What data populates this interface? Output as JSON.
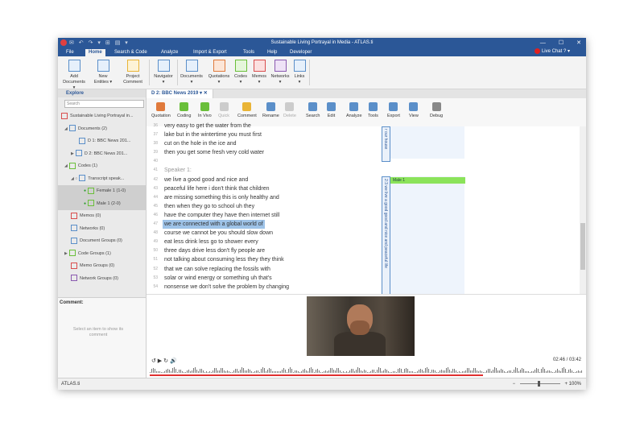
{
  "window": {
    "title": "Sustainable Living Portrayal in Media - ATLAS.ti",
    "controls": [
      "—",
      "☐",
      "✕"
    ],
    "quick_access": "✉ ↶ ↷ ▾   ⊞ ▤ ▾"
  },
  "menu": {
    "tabs": [
      "File",
      "Home",
      "Search & Code",
      "Analyze",
      "Import & Export",
      "Tools",
      "Help",
      "Developer"
    ],
    "active": "Home",
    "live_chat": "Live Chat",
    "help": "? ▾"
  },
  "ribbon": {
    "buttons": [
      {
        "l1": "Add",
        "l2": "Documents ▾",
        "color": "#5b8fc9"
      },
      {
        "l1": "New",
        "l2": "Entities ▾",
        "color": "#5b8fc9"
      },
      {
        "l1": "Project",
        "l2": "Comment",
        "color": "#e9b436"
      },
      {
        "l1": "Navigator",
        "l2": "▾",
        "color": "#5b8fc9"
      },
      {
        "l1": "Documents",
        "l2": "▾",
        "color": "#5b8fc9"
      },
      {
        "l1": "Quotations",
        "l2": "▾",
        "color": "#e07a3c"
      },
      {
        "l1": "Codes",
        "l2": "▾",
        "color": "#6abf3a"
      },
      {
        "l1": "Memos",
        "l2": "▾",
        "color": "#d94d4d"
      },
      {
        "l1": "Networks",
        "l2": "▾",
        "color": "#8a5ab0"
      },
      {
        "l1": "Links",
        "l2": "▾",
        "color": "#5b8fc9"
      }
    ]
  },
  "explore": {
    "title": "Explore",
    "search_placeholder": "Search",
    "items": [
      {
        "label": "Sustainable Living Portrayal in...",
        "indent": 2,
        "icon": "#d94d4d",
        "arrow": ""
      },
      {
        "label": "Documents (2)",
        "indent": 8,
        "icon": "#5b8fc9",
        "arrow": "◢"
      },
      {
        "label": "D 1: BBC News 201...",
        "indent": 24,
        "icon": "#5b8fc9",
        "arrow": ""
      },
      {
        "label": "D 2: BBC News 201...",
        "indent": 16,
        "icon": "#5b8fc9",
        "arrow": "▶"
      },
      {
        "label": "Codes (1)",
        "indent": 8,
        "icon": "#6abf3a",
        "arrow": "◢"
      },
      {
        "label": "Transcript speak...",
        "indent": 16,
        "icon": "#5b8fc9",
        "arrow": "◢ ○"
      },
      {
        "label": "Female 1 (1-0)",
        "indent": 32,
        "icon": "#6abf3a",
        "arrow": "●",
        "sel": true
      },
      {
        "label": "Male 1 (2-0)",
        "indent": 32,
        "icon": "#6abf3a",
        "arrow": "●",
        "sel": true
      },
      {
        "label": "Memos (0)",
        "indent": 14,
        "icon": "#d94d4d",
        "arrow": ""
      },
      {
        "label": "Networks (0)",
        "indent": 14,
        "icon": "#5b8fc9",
        "arrow": ""
      },
      {
        "label": "Document Groups (0)",
        "indent": 14,
        "icon": "#5b8fc9",
        "arrow": ""
      },
      {
        "label": "Code Groups (1)",
        "indent": 8,
        "icon": "#6abf3a",
        "arrow": "▶"
      },
      {
        "label": "Memo Groups (0)",
        "indent": 14,
        "icon": "#d94d4d",
        "arrow": ""
      },
      {
        "label": "Network Groups (0)",
        "indent": 14,
        "icon": "#8a5ab0",
        "arrow": ""
      }
    ],
    "comment_label": "Comment:",
    "comment_hint": "Select an item to show its comment"
  },
  "doc_tab": {
    "label": "D 2: BBC News 2019",
    "pin": "▾",
    "close": "✕"
  },
  "doc_toolbar": [
    {
      "label": "Quotation",
      "color": "#e07a3c",
      "disabled": false
    },
    {
      "label": "Coding",
      "color": "#6abf3a",
      "disabled": false
    },
    {
      "label": "In Vivo",
      "color": "#6abf3a",
      "disabled": false
    },
    {
      "label": "Quick",
      "color": "#cccccc",
      "disabled": true
    },
    {
      "label": "Comment",
      "color": "#e9b436",
      "disabled": false
    },
    {
      "label": "Rename",
      "color": "#5b8fc9",
      "disabled": false
    },
    {
      "label": "Delete",
      "color": "#cccccc",
      "disabled": true
    },
    {
      "label": "Search",
      "color": "#5b8fc9",
      "disabled": false
    },
    {
      "label": "Edit",
      "color": "#5b8fc9",
      "disabled": false
    },
    {
      "label": "Analyze",
      "color": "#5b8fc9",
      "disabled": false
    },
    {
      "label": "Tools",
      "color": "#5b8fc9",
      "disabled": false
    },
    {
      "label": "Export",
      "color": "#5b8fc9",
      "disabled": false
    },
    {
      "label": "View",
      "color": "#5b8fc9",
      "disabled": false
    },
    {
      "label": "Debug",
      "color": "#888888",
      "disabled": false
    }
  ],
  "transcript": [
    {
      "n": "36",
      "t": "very easy to get the water from the",
      "spk": false
    },
    {
      "n": "37",
      "t": "lake but in the wintertime you must first",
      "spk": false
    },
    {
      "n": "38",
      "t": "cut on the hole in the ice and",
      "spk": false
    },
    {
      "n": "39",
      "t": "then you get some fresh very cold water",
      "spk": false
    },
    {
      "n": "40",
      "t": "",
      "spk": false
    },
    {
      "n": "41",
      "t": "Speaker 1:",
      "spk": true
    },
    {
      "n": "42",
      "t": "we live a good good and nice and",
      "spk": false
    },
    {
      "n": "43",
      "t": "peaceful life here i don't think that children",
      "spk": false
    },
    {
      "n": "44",
      "t": "are missing something this is only healthy and",
      "spk": false
    },
    {
      "n": "45",
      "t": "then when they go to school uh they",
      "spk": false
    },
    {
      "n": "46",
      "t": "have the computer they have then internet still",
      "spk": false
    },
    {
      "n": "47",
      "t": "we are connected with a global world of",
      "spk": false,
      "hl": true
    },
    {
      "n": "48",
      "t": "course we cannot be you should slow down",
      "spk": false
    },
    {
      "n": "49",
      "t": "eat less drink less go to shower every",
      "spk": false
    },
    {
      "n": "50",
      "t": "three days drive less don't fly people are",
      "spk": false
    },
    {
      "n": "51",
      "t": "not talking about consuming less they they think",
      "spk": false
    },
    {
      "n": "52",
      "t": "that we can solve replacing the fossils with",
      "spk": false
    },
    {
      "n": "53",
      "t": "solar or wind energy or something uh that's",
      "spk": false
    },
    {
      "n": "54",
      "t": "nonsense we don't solve the problem by changing",
      "spk": false
    }
  ],
  "margin": {
    "bar1": "r our house",
    "bar2": "2:3 we live a good good and nice and peaceful life",
    "code": "Male 1"
  },
  "media": {
    "controls": "↺ ▶ ↻ 🔊",
    "time": "02:46 / 03:42",
    "progress": 0.77
  },
  "status": {
    "app": "ATLAS.ti",
    "zoom": "100%"
  }
}
